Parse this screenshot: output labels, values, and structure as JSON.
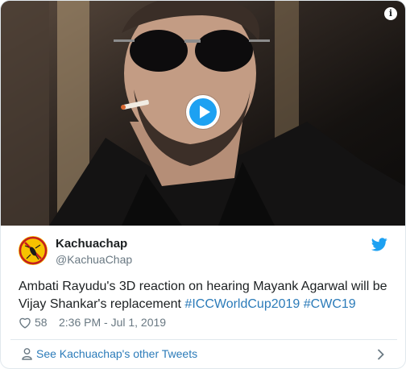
{
  "media": {
    "type": "video",
    "info_label": "i"
  },
  "author": {
    "display_name": "Kachuachap",
    "username": "@KachuaChap"
  },
  "tweet": {
    "text_plain": "Ambati Rayudu's 3D reaction on hearing Mayank Agarwal will be Vijay Shankar's replacement ",
    "hashtags": [
      "#ICCWorldCup2019",
      "#CWC19"
    ]
  },
  "meta": {
    "likes": "58",
    "timestamp": "2:36 PM - Jul 1, 2019"
  },
  "footer": {
    "link_label": "See Kachuachap's other Tweets"
  },
  "colors": {
    "link": "#2b7bb9",
    "twitter_blue": "#1da1f2",
    "muted": "#697882",
    "avatar_yellow": "#f6c200"
  }
}
